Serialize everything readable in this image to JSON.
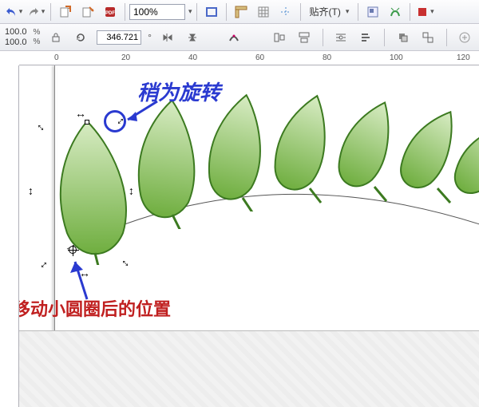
{
  "toolbar": {
    "zoom_value": "100%",
    "snap_label": "贴齐(T)"
  },
  "propbar": {
    "size_w": "100.0",
    "size_h": "100.0",
    "unit_w": "%",
    "unit_h": "%",
    "rotation": "346.721",
    "deg_symbol": "°"
  },
  "ruler": {
    "ticks": [
      "0",
      "20",
      "40",
      "60",
      "80",
      "100",
      "120"
    ]
  },
  "annotations": {
    "rotate_hint": "稍为旋转",
    "moved_hint": "移动小圆圈后的位置"
  },
  "icons": {
    "undo": "undo-icon",
    "redo": "redo-icon",
    "import": "import-icon",
    "export": "export-icon",
    "pdf": "pdf-icon",
    "fullscreen": "fullscreen-icon",
    "rulers": "rulers-icon",
    "grid": "grid-icon",
    "guides": "guides-icon",
    "options": "options-icon",
    "effects": "effects-icon",
    "fill": "fill-icon",
    "lock": "lock-icon",
    "reload": "reload-icon",
    "mirror_h": "mirror-h-icon",
    "mirror_v": "mirror-v-icon",
    "align_a": "align-a-icon",
    "align_b": "align-b-icon",
    "align_c": "align-c-icon",
    "wrap": "wrap-icon",
    "order": "order-icon",
    "to_front": "to-front-icon",
    "group": "group-icon",
    "add": "add-icon"
  },
  "leaves": {
    "fill_top": "#d8ecc4",
    "fill_bottom": "#6fae3f",
    "stroke": "#3c7a20",
    "stem": "#3c7a20"
  }
}
